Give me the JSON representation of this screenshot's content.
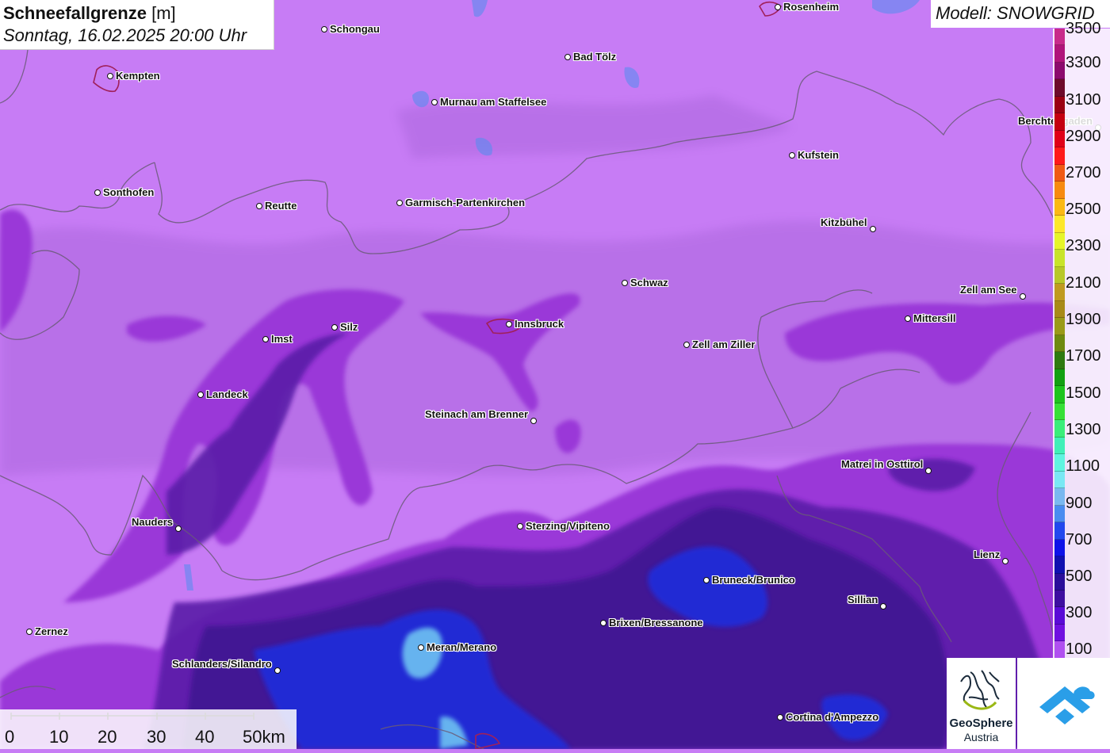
{
  "title": {
    "main": "Schneefallgrenze",
    "unit": "[m]",
    "datetime": "Sonntag, 16.02.2025 20:00 Uhr"
  },
  "model_label": "Modell: SNOWGRID",
  "legend": {
    "labels": [
      "3500",
      "3300",
      "3100",
      "2900",
      "2700",
      "2500",
      "2300",
      "2100",
      "1900",
      "1700",
      "1500",
      "1300",
      "1100",
      "900",
      "700",
      "500",
      "300",
      "100"
    ],
    "colors": [
      "#c82a8a",
      "#b0147a",
      "#8c0a6e",
      "#6e0a2a",
      "#9a0012",
      "#c40010",
      "#e00018",
      "#ff1a1a",
      "#f05a14",
      "#f78a10",
      "#fbb914",
      "#fde72a",
      "#e6f52a",
      "#c8e42a",
      "#b8c828",
      "#c09a20",
      "#a88a18",
      "#9a9a18",
      "#6e8a10",
      "#2e7a10",
      "#12a012",
      "#1ec41e",
      "#36e036",
      "#3aee7a",
      "#40f0b8",
      "#60f4e0",
      "#7ae8f4",
      "#7ab8f0",
      "#4a8cf0",
      "#2248ee",
      "#0e12e8",
      "#1010b0",
      "#2a0e9a",
      "#3e0ea0",
      "#5a0ad6",
      "#7010e0",
      "#b050f0"
    ]
  },
  "cities": [
    {
      "name": "Rosenheim"
    },
    {
      "name": "Schongau"
    },
    {
      "name": "Kempten"
    },
    {
      "name": "Bad Tölz"
    },
    {
      "name": "Murnau am Staffelsee"
    },
    {
      "name": "Berchtesgaden"
    },
    {
      "name": "Kufstein"
    },
    {
      "name": "Sonthofen"
    },
    {
      "name": "Reutte"
    },
    {
      "name": "Garmisch-Partenkirchen"
    },
    {
      "name": "Kitzbühel"
    },
    {
      "name": "Schwaz"
    },
    {
      "name": "Zell am See"
    },
    {
      "name": "Mittersill"
    },
    {
      "name": "Imst"
    },
    {
      "name": "Silz"
    },
    {
      "name": "Innsbruck"
    },
    {
      "name": "Zell am Ziller"
    },
    {
      "name": "Landeck"
    },
    {
      "name": "Steinach am Brenner"
    },
    {
      "name": "Matrei in Osttirol"
    },
    {
      "name": "Nauders"
    },
    {
      "name": "Sterzing/Vipiteno"
    },
    {
      "name": "Lienz"
    },
    {
      "name": "Bruneck/Brunico"
    },
    {
      "name": "Sillian"
    },
    {
      "name": "Brixen/Bressanone"
    },
    {
      "name": "Zernez"
    },
    {
      "name": "Meran/Merano"
    },
    {
      "name": "Schlanders/Silandro"
    },
    {
      "name": "Cortina d'Ampezzo"
    }
  ],
  "scale": {
    "labels": [
      "0",
      "10",
      "20",
      "30",
      "40",
      "50km"
    ]
  },
  "logo": {
    "line1": "GeoSphere",
    "line2": "Austria"
  }
}
